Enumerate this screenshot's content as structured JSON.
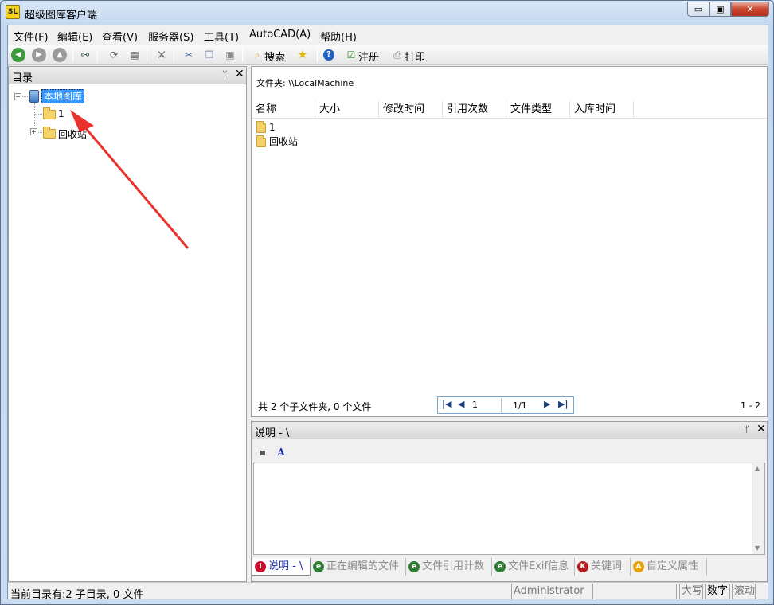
{
  "window": {
    "title": "超级图库客户端",
    "app_icon_text": "SL",
    "min_glyph": "▭",
    "max_glyph": "▣",
    "close_glyph": "✕"
  },
  "menu": [
    "文件(F)",
    "编辑(E)",
    "查看(V)",
    "服务器(S)",
    "工具(T)",
    "AutoCAD(A)",
    "帮助(H)"
  ],
  "toolbar": {
    "search_label": "搜索",
    "register_label": "注册",
    "print_label": "打印"
  },
  "tree_pane": {
    "title": "目录",
    "pin_glyph": "ᛘ",
    "close_glyph": "✕",
    "nodes": [
      {
        "label": "本地图库",
        "selected": true
      },
      {
        "label": "1"
      },
      {
        "label": "回收站"
      }
    ]
  },
  "file_pane": {
    "folder_path": "文件夹: \\\\LocalMachine",
    "columns": [
      "名称",
      "大小",
      "修改时间",
      "引用次数",
      "文件类型",
      "入库时间"
    ],
    "rows": [
      "1",
      "回收站"
    ],
    "summary": "共 2 个子文件夹, 0 个文件",
    "pager": {
      "page": "1",
      "total": "1/1"
    },
    "range": "1 - 2"
  },
  "desc_pane": {
    "title": "说明 - \\",
    "tabs": [
      {
        "label": "说明 - \\",
        "icon": "i",
        "color": "#c8102e",
        "active": true
      },
      {
        "label": "正在编辑的文件",
        "icon": "e",
        "color": "#2e7d32"
      },
      {
        "label": "文件引用计数",
        "icon": "e",
        "color": "#2e7d32"
      },
      {
        "label": "文件Exif信息",
        "icon": "e",
        "color": "#2e7d32"
      },
      {
        "label": "关键词",
        "icon": "K",
        "color": "#b71c1c"
      },
      {
        "label": "自定义属性",
        "icon": "A",
        "color": "#e6a100"
      }
    ]
  },
  "statusbar": {
    "text": "当前目录有:2 子目录, 0 文件",
    "user": "Administrator",
    "caps": "大写",
    "num": "数字",
    "scroll": "滚动"
  },
  "colors": {
    "annotation_arrow": "#e8322b",
    "selection": "#3399ff"
  }
}
